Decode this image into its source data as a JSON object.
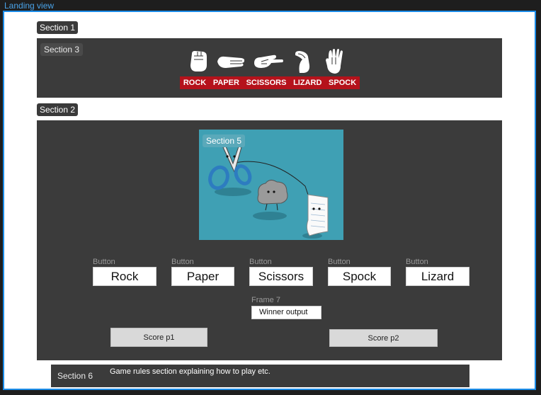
{
  "frame": {
    "title": "Landing view"
  },
  "sections": {
    "s1": "Section 1",
    "s2": "Section 2",
    "s3": "Section 3",
    "s5": "Section 5",
    "s6": "Section 6"
  },
  "header": {
    "gestures": [
      "ROCK",
      "PAPER",
      "SCISSORS",
      "LIZARD",
      "SPOCK"
    ],
    "accent": "#b5121b"
  },
  "hero_image": {
    "bg": "#3fa0b4"
  },
  "buttons": [
    {
      "caption": "Button",
      "label": "Rock"
    },
    {
      "caption": "Button",
      "label": "Paper"
    },
    {
      "caption": "Button",
      "label": "Scissors"
    },
    {
      "caption": "Button",
      "label": "Spock"
    },
    {
      "caption": "Button",
      "label": "Lizard"
    }
  ],
  "frame7": {
    "caption": "Frame 7",
    "winner": "Winner output"
  },
  "scores": {
    "p1": "Score p1",
    "p2": "Score p2"
  },
  "rules": {
    "text": "Game rules section explaining how to play etc."
  }
}
